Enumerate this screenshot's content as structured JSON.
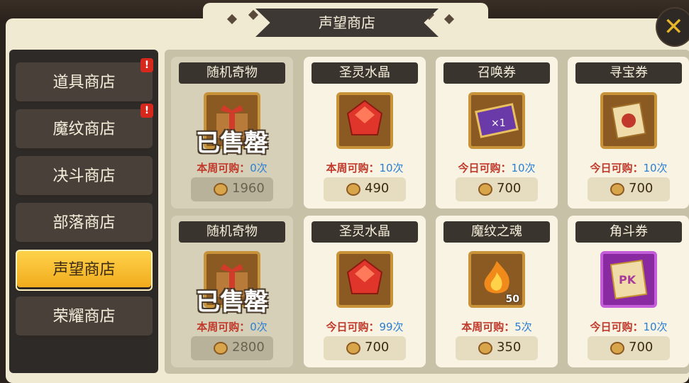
{
  "header": {
    "title": "声望商店",
    "close_icon": "close-icon"
  },
  "sidebar": {
    "items": [
      {
        "label": "道具商店",
        "alert": "!"
      },
      {
        "label": "魔纹商店",
        "alert": "!"
      },
      {
        "label": "决斗商店"
      },
      {
        "label": "部落商店"
      },
      {
        "label": "声望商店",
        "active": true
      },
      {
        "label": "荣耀商店"
      }
    ]
  },
  "shop": {
    "items": [
      {
        "name": "随机奇物",
        "limit_label": "本周可购：",
        "limit_value": "0次",
        "price": "1960",
        "sold_label": "已售罄",
        "icon": "gift-box-icon"
      },
      {
        "name": "圣灵水晶",
        "limit_label": "本周可购：",
        "limit_value": "10次",
        "price": "490",
        "icon": "red-crystal-icon"
      },
      {
        "name": "召唤券",
        "limit_label": "今日可购：",
        "limit_value": "10次",
        "price": "700",
        "icon": "summon-ticket-icon"
      },
      {
        "name": "寻宝券",
        "limit_label": "今日可购：",
        "limit_value": "10次",
        "price": "700",
        "icon": "treasure-scroll-icon"
      },
      {
        "name": "随机奇物",
        "limit_label": "本周可购：",
        "limit_value": "0次",
        "price": "2800",
        "sold_label": "已售罄",
        "icon": "gift-box-icon"
      },
      {
        "name": "圣灵水晶",
        "limit_label": "今日可购：",
        "limit_value": "99次",
        "price": "700",
        "icon": "red-crystal-icon"
      },
      {
        "name": "魔纹之魂",
        "limit_label": "本周可购：",
        "limit_value": "5次",
        "price": "350",
        "quantity": "50",
        "icon": "fire-soul-icon"
      },
      {
        "name": "角斗券",
        "limit_label": "今日可购：",
        "limit_value": "10次",
        "price": "700",
        "icon": "pk-ticket-icon",
        "pk_text": "PK"
      }
    ]
  },
  "colors": {
    "accent": "#f0a91a",
    "limit_red": "#c0392b",
    "limit_blue": "#2a7fd4",
    "panel": "#f1ead2"
  }
}
